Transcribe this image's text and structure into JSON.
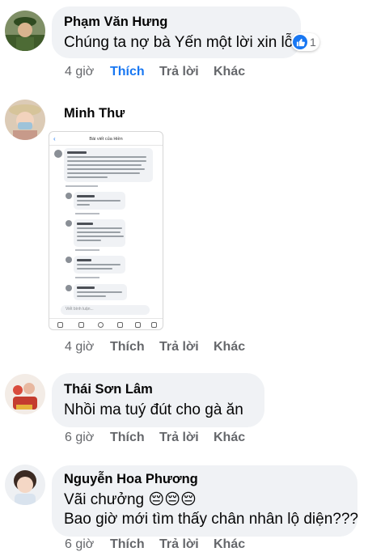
{
  "comments": [
    {
      "name": "Phạm Văn Hưng",
      "text": "Chúng ta nợ bà Yến một lời xin lỗi",
      "time": "4 giờ",
      "like": "Thích",
      "reply": "Trả lời",
      "more": "Khác",
      "reaction_count": "1",
      "like_active": true
    },
    {
      "name": "Minh Thư",
      "time": "4 giờ",
      "like": "Thích",
      "reply": "Trả lời",
      "more": "Khác",
      "embedded_screenshot": {
        "title": "Bài viết của Hiền",
        "input_placeholder": "Viết bình luận..."
      }
    },
    {
      "name": "Thái Sơn Lâm",
      "text": "Nhồi ma tuý đút cho gà ăn",
      "time": "6 giờ",
      "like": "Thích",
      "reply": "Trả lời",
      "more": "Khác"
    },
    {
      "name": "Nguyễn Hoa Phương",
      "text_line1": "Vãi chưởng 😔😔😔",
      "text_line2": "Bao giờ mới tìm thấy chân nhân lộ diện???",
      "time": "6 giờ",
      "like": "Thích",
      "reply": "Trả lời",
      "more": "Khác"
    }
  ],
  "colors": {
    "bubble": "#f0f2f5",
    "link_blue": "#1877f2",
    "meta_gray": "#65676b"
  }
}
